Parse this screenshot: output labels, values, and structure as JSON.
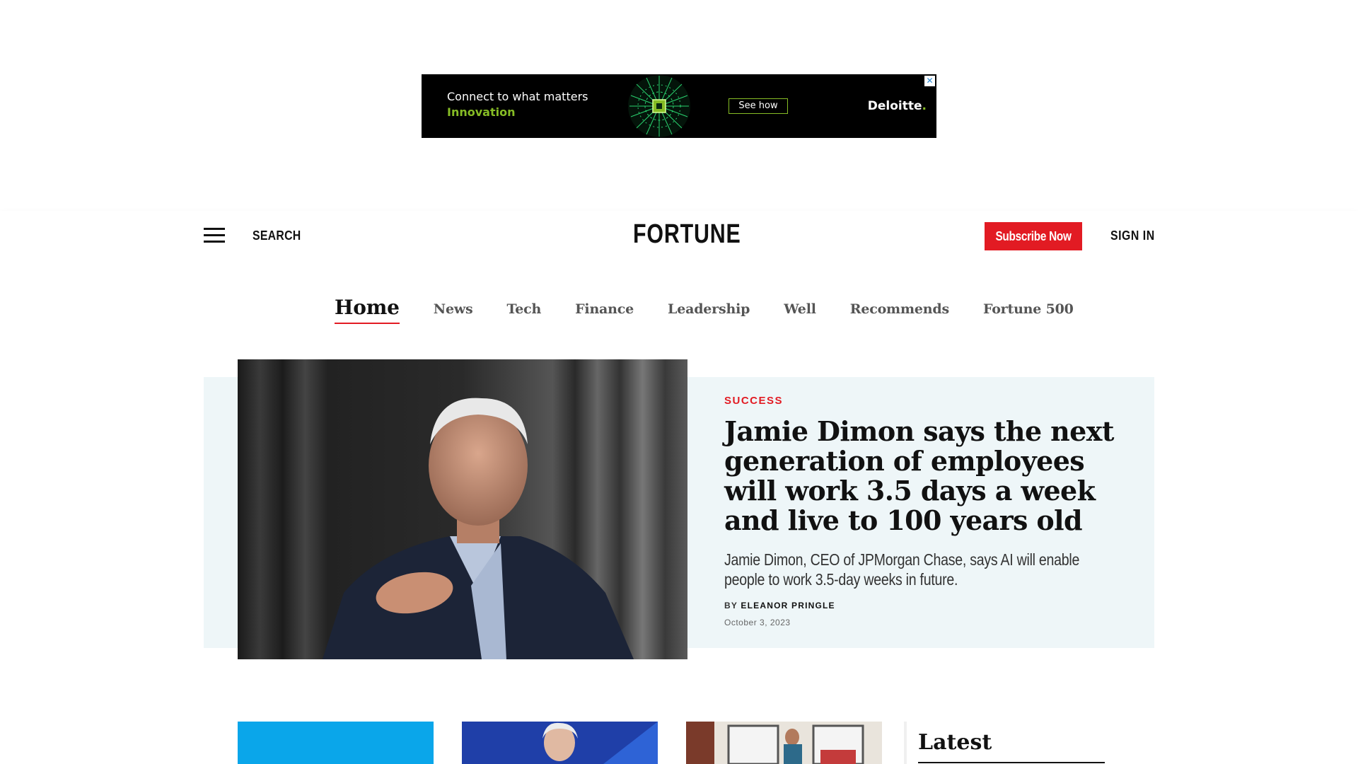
{
  "ad": {
    "line1": "Connect to what matters",
    "line2": "Innovation",
    "cta": "See how",
    "brand": "Deloitte",
    "brand_dot": ".",
    "close": "✕",
    "accent_color": "#86bc25"
  },
  "header": {
    "search_label": "SEARCH",
    "logo": "FORTUNE",
    "subscribe_label": "Subscribe Now",
    "signin_label": "SIGN IN",
    "brand_color": "#e21b23"
  },
  "nav": {
    "items": [
      {
        "label": "Home",
        "active": true
      },
      {
        "label": "News"
      },
      {
        "label": "Tech"
      },
      {
        "label": "Finance"
      },
      {
        "label": "Leadership"
      },
      {
        "label": "Well"
      },
      {
        "label": "Recommends"
      },
      {
        "label": "Fortune 500"
      }
    ]
  },
  "hero": {
    "kicker": "SUCCESS",
    "headline": "Jamie Dimon says the next generation of employees will work 3.5 days a week and live to 100 years old",
    "dek": "Jamie Dimon, CEO of JPMorgan Chase, says AI will enable people to work 3.5-day weeks in future.",
    "by": "BY",
    "author": "ELEANOR PRINGLE",
    "date": "October 3, 2023"
  },
  "latest": {
    "title": "Latest"
  }
}
